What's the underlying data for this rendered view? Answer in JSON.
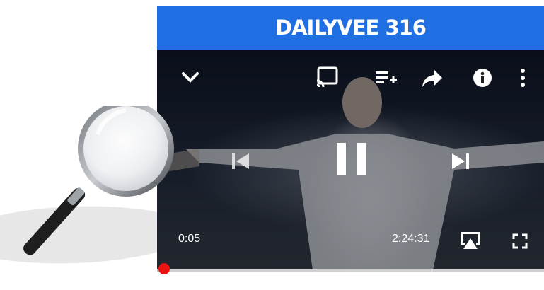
{
  "video": {
    "title": "DAILYVEE 316",
    "elapsed": "0:05",
    "duration": "2:24:31",
    "progress_fraction": 0.0,
    "banner_color": "#1f6fe3",
    "progress_color": "#ee1111"
  },
  "icons": {
    "top_bar": [
      "chevron-down-icon",
      "cast-icon",
      "add-to-queue-icon",
      "share-icon",
      "info-icon",
      "more-vert-icon"
    ],
    "center": [
      "skip-previous-icon",
      "pause-icon",
      "skip-next-icon"
    ],
    "bottom": [
      "airplay-icon",
      "fullscreen-icon"
    ],
    "decorative": [
      "magnifying-glass-icon"
    ]
  }
}
